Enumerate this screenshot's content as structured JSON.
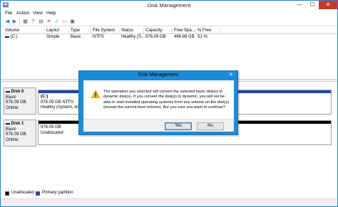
{
  "window": {
    "title": "Disk Management",
    "min_label": "—",
    "max_label": "☐",
    "close_label": "✕"
  },
  "menu": {
    "items": [
      "File",
      "Action",
      "View",
      "Help"
    ]
  },
  "toolbar": {
    "icons": [
      "back-icon",
      "forward-icon",
      "console-tree-icon",
      "help-icon",
      "properties-icon",
      "close-x-icon",
      "check-icon",
      "open-icon",
      "window-icon"
    ]
  },
  "volume_list": {
    "columns": [
      "Volume",
      "Layout",
      "Type",
      "File System",
      "Status",
      "Capacity",
      "Free Spa...",
      "% Free"
    ],
    "rows": [
      {
        "volume": "(C:)",
        "layout": "Simple",
        "type": "Basic",
        "fs": "NTFS",
        "status": "Healthy (S...",
        "capacity": "976.09 GB",
        "free": "496.86 GB",
        "pct": "51 %"
      }
    ]
  },
  "disks": [
    {
      "name": "Disk 0",
      "type": "Basic",
      "size": "976.09 GB",
      "status": "Online",
      "partition": {
        "label": "(C:)",
        "detail": "976.09 GB NTFS",
        "state": "Healthy (System, Boot, Page File, Active, Crash Dump, Primary Partition)"
      }
    },
    {
      "name": "Disk 1",
      "type": "Basic",
      "size": "976.09 GB",
      "status": "Online",
      "partition": {
        "label": "976.09 GB",
        "detail": "Unallocated"
      }
    }
  ],
  "legend": {
    "unallocated": "Unallocated",
    "primary": "Primary partition"
  },
  "dialog": {
    "title": "Disk Management",
    "close_label": "✕",
    "message": "The operation you selected will convert the selected basic disk(s) to dynamic disk(s). If you convert the disk(s) to dynamic, you will not be able to start installed operating systems from any volume on the disk(s) (except the current boot volume). Are you sure you want to continue?",
    "yes_label": "Yes",
    "no_label": "No"
  },
  "colors": {
    "accent": "#1c8cd8",
    "primary_partition": "#1b47a8",
    "unallocated": "#000000"
  }
}
